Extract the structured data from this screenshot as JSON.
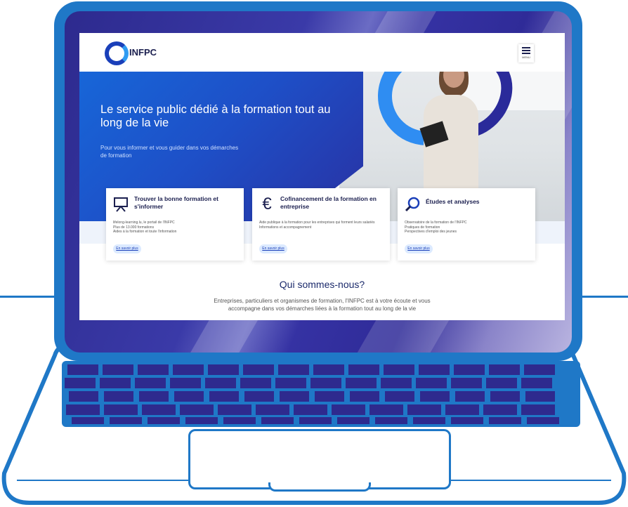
{
  "logo": {
    "text": "INFPC"
  },
  "menu": {
    "label": "MENU"
  },
  "hero": {
    "title": "Le service public dédié à la formation tout au long de la vie",
    "subtitle": "Pour vous informer et vous guider dans vos démarches de formation"
  },
  "cards": [
    {
      "icon": "presentation-board-icon",
      "title": "Trouver la bonne formation et s'informer",
      "body": "lifelong-learning.lu, le portail de l'INFPC\nPlus de 13.000 formations\nAides à la formation et toute l'information",
      "button": "En savoir plus"
    },
    {
      "icon": "euro-icon",
      "title": "Cofinancement de la formation en entreprise",
      "body": "Aide publique à la formation pour les entreprises qui forment leurs salariés\nInformations et accompagnement",
      "button": "En savoir plus"
    },
    {
      "icon": "search-icon",
      "title": "Études et analyses",
      "body": "Observatoire de la formation de l'INFPC\nPratiques de formation\nPerspectives d'emploi des jeunes",
      "button": "En savoir plus"
    }
  ],
  "about": {
    "title": "Qui sommes-nous?",
    "text": "Entreprises, particuliers et organismes de formation, l'INFPC est à votre écoute et vous accompagne dans vos démarches liées à la formation tout au long de la vie"
  },
  "colors": {
    "frame": "#1f78c7",
    "hero_blue": "#1e4fc7",
    "bezel_indigo": "#2d2a8e",
    "accent_light_blue": "#2f8df2"
  }
}
